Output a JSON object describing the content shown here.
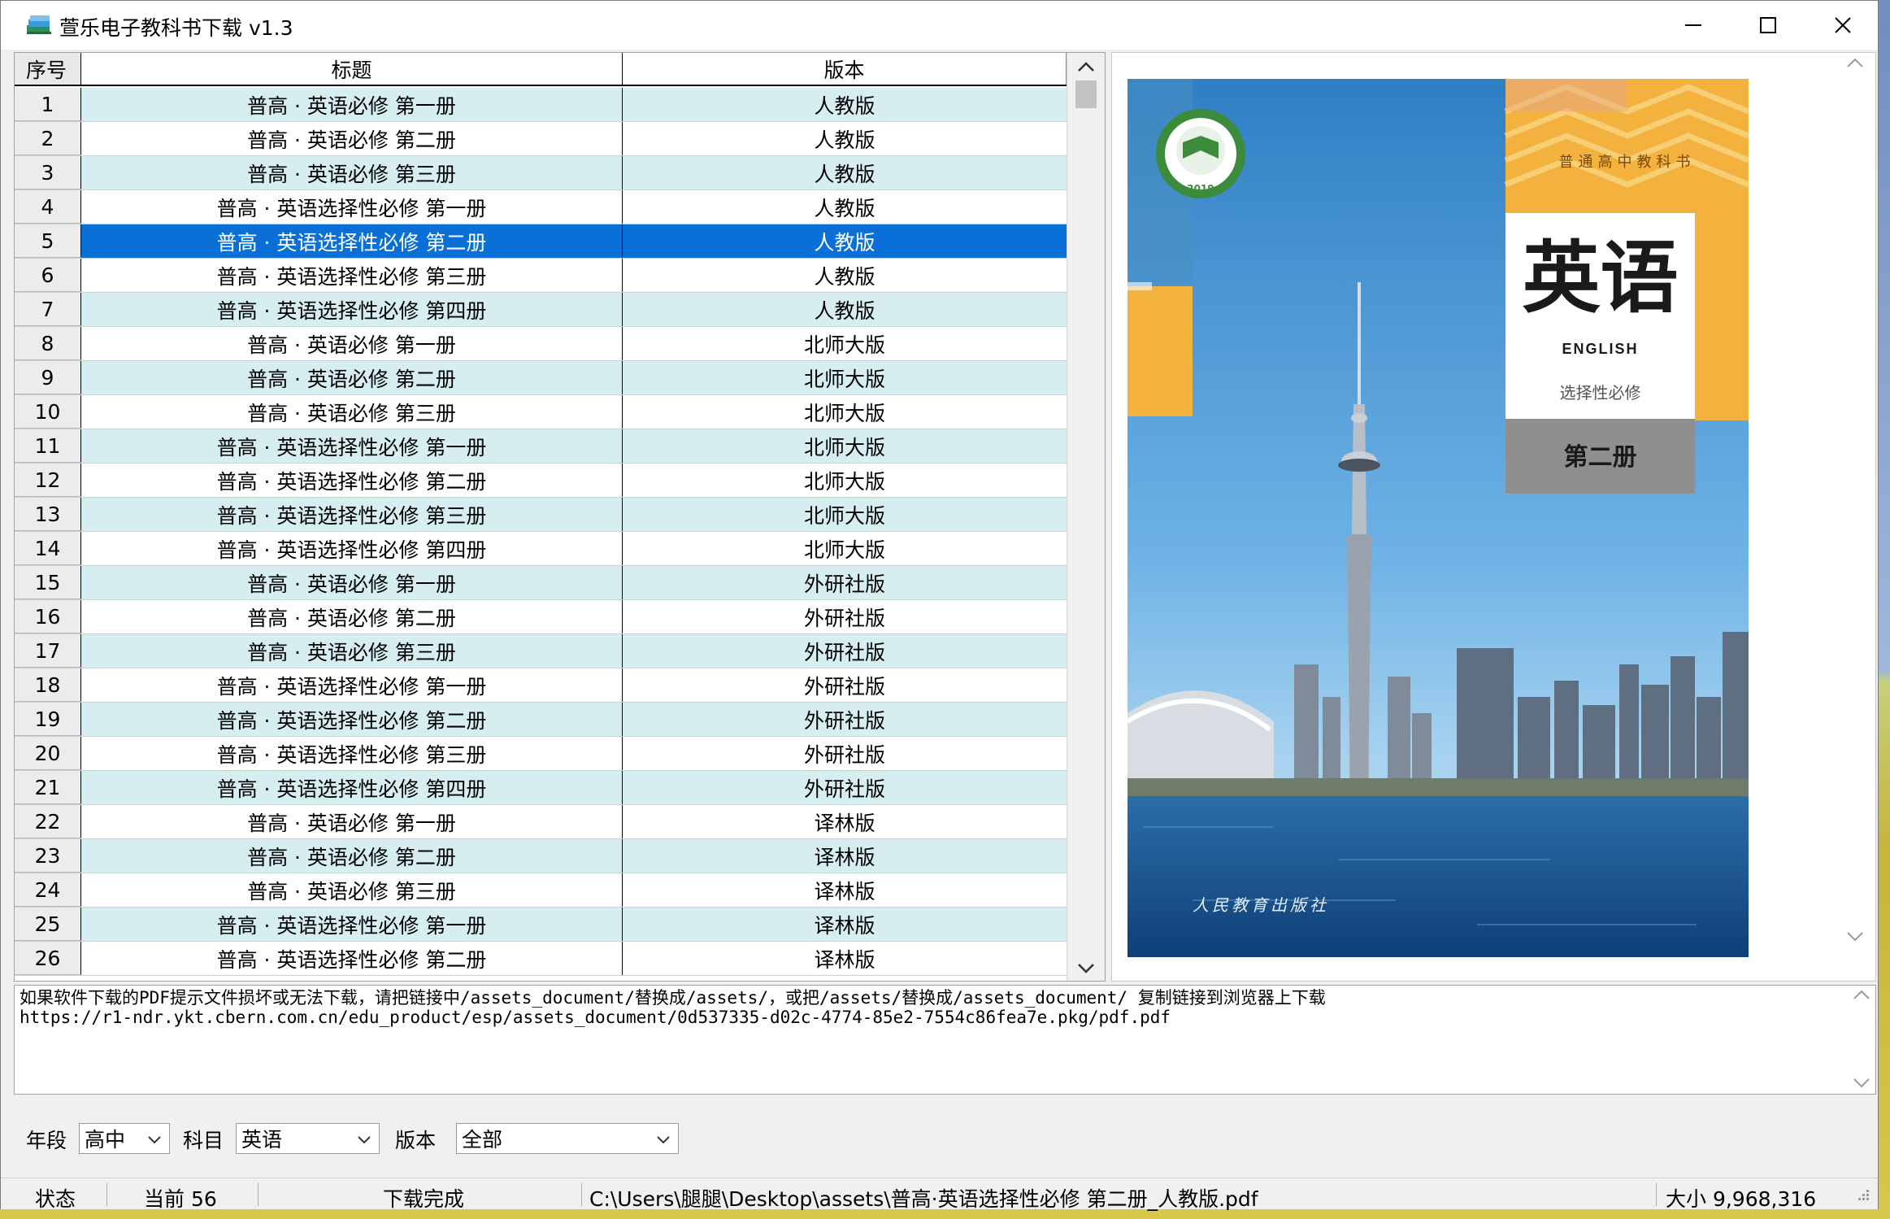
{
  "window": {
    "title": "萱乐电子教科书下载 v1.3",
    "controls": [
      "minimize",
      "maximize",
      "close"
    ]
  },
  "table": {
    "columns": [
      "序号",
      "标题",
      "版本"
    ],
    "selected_row": 5,
    "rows": [
      {
        "idx": "1",
        "title": "普高 · 英语必修 第一册",
        "edition": "人教版"
      },
      {
        "idx": "2",
        "title": "普高 · 英语必修 第二册",
        "edition": "人教版"
      },
      {
        "idx": "3",
        "title": "普高 · 英语必修 第三册",
        "edition": "人教版"
      },
      {
        "idx": "4",
        "title": "普高 · 英语选择性必修 第一册",
        "edition": "人教版"
      },
      {
        "idx": "5",
        "title": "普高 · 英语选择性必修 第二册",
        "edition": "人教版"
      },
      {
        "idx": "6",
        "title": "普高 · 英语选择性必修 第三册",
        "edition": "人教版"
      },
      {
        "idx": "7",
        "title": "普高 · 英语选择性必修 第四册",
        "edition": "人教版"
      },
      {
        "idx": "8",
        "title": "普高 · 英语必修 第一册",
        "edition": "北师大版"
      },
      {
        "idx": "9",
        "title": "普高 · 英语必修 第二册",
        "edition": "北师大版"
      },
      {
        "idx": "10",
        "title": "普高 · 英语必修 第三册",
        "edition": "北师大版"
      },
      {
        "idx": "11",
        "title": "普高 · 英语选择性必修 第一册",
        "edition": "北师大版"
      },
      {
        "idx": "12",
        "title": "普高 · 英语选择性必修 第二册",
        "edition": "北师大版"
      },
      {
        "idx": "13",
        "title": "普高 · 英语选择性必修 第三册",
        "edition": "北师大版"
      },
      {
        "idx": "14",
        "title": "普高 · 英语选择性必修 第四册",
        "edition": "北师大版"
      },
      {
        "idx": "15",
        "title": "普高 · 英语必修 第一册",
        "edition": "外研社版"
      },
      {
        "idx": "16",
        "title": "普高 · 英语必修 第二册",
        "edition": "外研社版"
      },
      {
        "idx": "17",
        "title": "普高 · 英语必修 第三册",
        "edition": "外研社版"
      },
      {
        "idx": "18",
        "title": "普高 · 英语选择性必修 第一册",
        "edition": "外研社版"
      },
      {
        "idx": "19",
        "title": "普高 · 英语选择性必修 第二册",
        "edition": "外研社版"
      },
      {
        "idx": "20",
        "title": "普高 · 英语选择性必修 第三册",
        "edition": "外研社版"
      },
      {
        "idx": "21",
        "title": "普高 · 英语选择性必修 第四册",
        "edition": "外研社版"
      },
      {
        "idx": "22",
        "title": "普高 · 英语必修 第一册",
        "edition": "译林版"
      },
      {
        "idx": "23",
        "title": "普高 · 英语必修 第二册",
        "edition": "译林版"
      },
      {
        "idx": "24",
        "title": "普高 · 英语必修 第三册",
        "edition": "译林版"
      },
      {
        "idx": "25",
        "title": "普高 · 英语选择性必修 第一册",
        "edition": "译林版"
      },
      {
        "idx": "26",
        "title": "普高 · 英语选择性必修 第二册",
        "edition": "译林版"
      }
    ]
  },
  "cover": {
    "series": "普通高中教科书",
    "subject": "英语",
    "subject_en": "ENGLISH",
    "course": "选择性必修",
    "volume": "第二册",
    "publisher": "人民教育出版社",
    "seal_year": "2019"
  },
  "log": {
    "line1": "如果软件下载的PDF提示文件损坏或无法下载，请把链接中/assets_document/替换成/assets/，或把/assets/替换成/assets_document/  复制链接到浏览器上下载",
    "line2": "https://r1-ndr.ykt.cbern.com.cn/edu_product/esp/assets_document/0d537335-d02c-4774-85e2-7554c86fea7e.pkg/pdf.pdf"
  },
  "filters": {
    "grade_label": "年段",
    "grade_value": "高中",
    "subject_label": "科目",
    "subject_value": "英语",
    "edition_label": "版本",
    "edition_value": "全部"
  },
  "status": {
    "label": "状态",
    "current": "当前 56",
    "state": "下载完成",
    "path": "C:\\Users\\腿腿\\Desktop\\assets\\普高·英语选择性必修 第二册_人教版.pdf",
    "size": "大小 9,968,316"
  },
  "colors": {
    "row_alt": "#d6eef0",
    "row_selected": "#0a6fd7",
    "cover_orange": "#f3b13e",
    "cover_gray": "#8f8f8f",
    "seal_green": "#3c8a3c"
  }
}
